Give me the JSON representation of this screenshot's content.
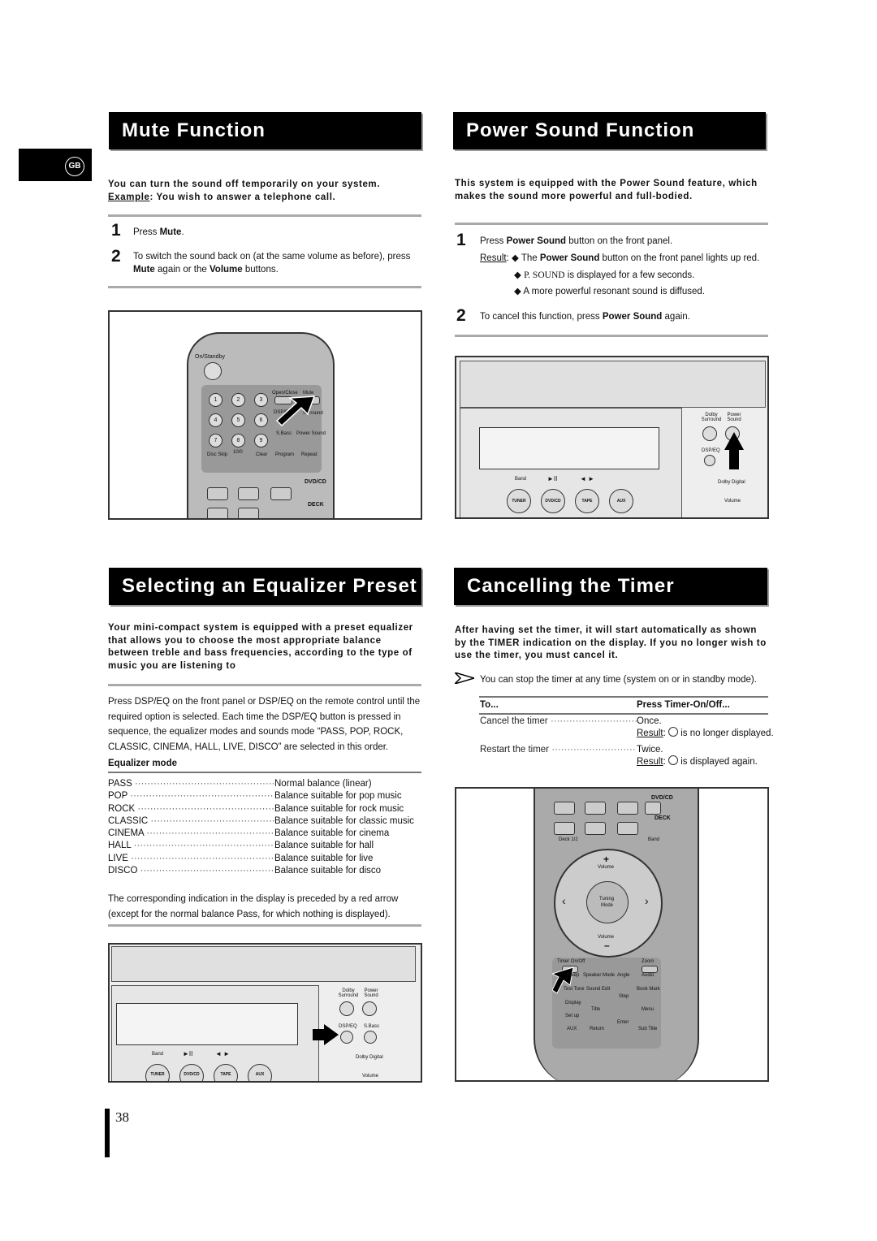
{
  "lang_badge": "GB",
  "page_number": "38",
  "mute": {
    "title": "Mute Function",
    "intro_line1": "You can turn the sound off temporarily on your system.",
    "example_label": "Example",
    "example_text": ": You wish to answer a telephone call.",
    "steps": [
      {
        "num": "1",
        "pre": "Press ",
        "bold": "Mute",
        "post": "."
      },
      {
        "num": "2",
        "pre": "To switch the sound back on (at the same volume as before), press ",
        "bold": "Mute",
        "mid": " again or the ",
        "bold2": "Volume",
        "post": " buttons."
      }
    ],
    "remote_labels": {
      "on_standby": "On/Standby",
      "open_close": "Open/Close",
      "mute": "Mute",
      "dsp_eq": "DSP/EQ",
      "surround": "Surround",
      "sbass": "S.Bass",
      "power_sound": "Power Sound",
      "disc_skip": "Disc Skip",
      "ten_zero": "10/0",
      "clear": "Clear",
      "program": "Program",
      "repeat": "Repeat",
      "dvd_cd": "DVD/CD",
      "deck": "DECK",
      "digits": [
        "1",
        "2",
        "3",
        "4",
        "5",
        "6",
        "7",
        "8",
        "9"
      ]
    }
  },
  "power": {
    "title": "Power Sound Function",
    "intro": "This system is equipped with the Power Sound feature, which makes the sound more powerful and full-bodied.",
    "step1_pre": "Press ",
    "step1_bold": "Power Sound",
    "step1_post": " button on the front panel.",
    "result_label": "Result",
    "r1_pre": "The ",
    "r1_bold": "Power Sound",
    "r1_post": " button on the front panel lights up red.",
    "r2_bold": "P. SOUND",
    "r2_post": " is displayed for a few seconds.",
    "r3": "A more powerful resonant sound is diffused.",
    "step2_pre": "To cancel this function, press ",
    "step2_bold": "Power Sound",
    "step2_post": " again.",
    "panel_labels": {
      "dolby_surround": "Dolby Surround",
      "power_sound": "Power Sound",
      "dsp_eq": "DSP/EQ",
      "band": "Band",
      "play_pause": "►II",
      "skip": "◄ ►",
      "dolby_digital": "Dolby Digital",
      "volume": "Volume",
      "tuner": "TUNER",
      "dvd_cd": "DVD/CD",
      "tape": "TAPE",
      "aux": "AUX"
    }
  },
  "eq": {
    "title": "Selecting an Equalizer Preset",
    "intro": "Your mini-compact system is equipped with a preset equalizer that allows you to choose the most appropriate balance between treble and bass frequencies, according to the type of music you are listening to",
    "p1": "Press DSP/EQ on the front panel or DSP/EQ on the remote control until the required option is selected. Each time the DSP/EQ button is pressed in sequence, the equalizer modes and sounds mode “PASS, POP, ROCK, CLASSIC, CINEMA, HALL, LIVE, DISCO” are selected in this order.",
    "mode_header": "Equalizer mode",
    "modes": [
      {
        "name": "PASS",
        "desc": "Normal balance (linear)"
      },
      {
        "name": "POP",
        "desc": "Balance suitable for pop music"
      },
      {
        "name": "ROCK",
        "desc": "Balance suitable for rock music"
      },
      {
        "name": "CLASSIC",
        "desc": "Balance suitable for classic music"
      },
      {
        "name": "CINEMA",
        "desc": "Balance suitable for cinema"
      },
      {
        "name": "HALL",
        "desc": "Balance suitable for hall"
      },
      {
        "name": "LIVE",
        "desc": "Balance suitable for live"
      },
      {
        "name": "DISCO",
        "desc": "Balance suitable for disco"
      }
    ],
    "p2": "The corresponding indication in the display is preceded by a red arrow (except for the normal balance Pass, for which nothing is displayed).",
    "panel_labels": {
      "dolby_surround": "Dolby Surround",
      "power_sound": "Power Sound",
      "dsp_eq": "DSP/EQ",
      "sbass": "S.Bass",
      "band": "Band",
      "play_pause": "►II",
      "skip": "◄ ►",
      "dolby_digital": "Dolby Digital",
      "volume": "Volume",
      "tuner": "TUNER",
      "dvd_cd": "DVD/CD",
      "tape": "TAPE",
      "aux": "AUX"
    }
  },
  "timer": {
    "title": "Cancelling the Timer",
    "intro": "After having set the timer, it will start automatically as shown by the TIMER indication on the display. If you no longer wish to use the timer, you must cancel it.",
    "note": "You can stop the timer at any time (system on or in standby mode).",
    "col1": "To...",
    "col2": "Press Timer-On/Off...",
    "rows": [
      {
        "action": "Cancel the timer",
        "press": "Once.",
        "result_label": "Result",
        "result": "is no longer displayed."
      },
      {
        "action": "Restart the timer",
        "press": "Twice.",
        "result_label": "Result",
        "result": "is displayed again."
      }
    ],
    "remote_labels": {
      "dvd_cd": "DVD/CD",
      "deck": "DECK",
      "deck12": "Deck 1/2",
      "band": "Band",
      "volume_plus": "+",
      "volume": "Volume",
      "tuning": "Tuning",
      "mode": "Mode",
      "volume_minus": "–",
      "timer_onoff": "Timer On/Off",
      "zoom": "Zoom",
      "sleep": "Sleep",
      "speaker_mode": "Speaker Mode",
      "angle": "Angle",
      "audio": "Audio",
      "test_tone": "Test Tone",
      "sound_edit": "Sound Edit",
      "book_mark": "Book Mark",
      "step": "Step",
      "display": "Display",
      "title": "Title",
      "menu": "Menu",
      "setup": "Set up",
      "enter": "Enter",
      "aux": "AUX",
      "return": "Return",
      "sub_title": "Sub Title"
    }
  }
}
